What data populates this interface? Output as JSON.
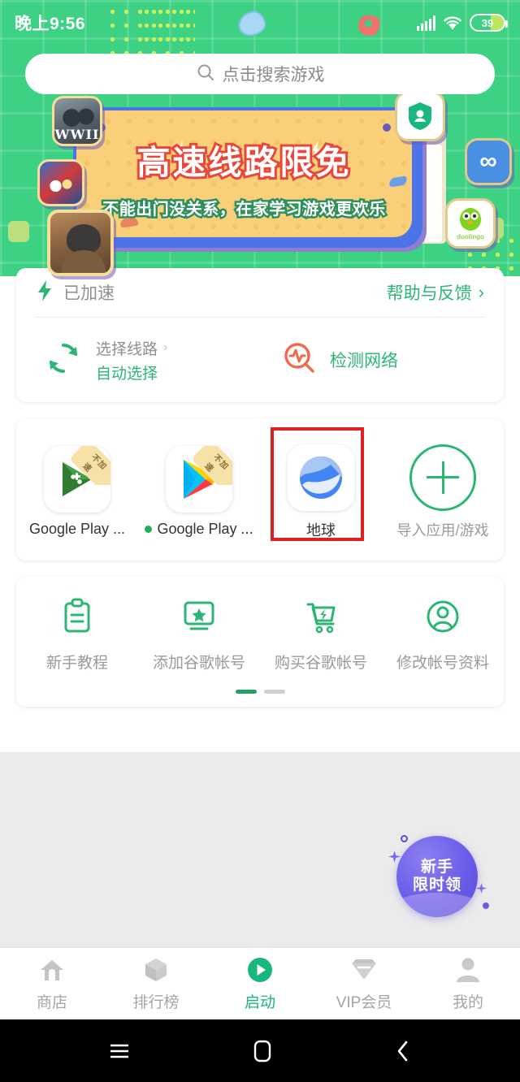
{
  "statusbar": {
    "time": "晚上9:56",
    "battery_percent": "39",
    "signal_icon": "signal-bars-icon",
    "wifi_icon": "wifi-icon",
    "battery_icon": "battery-icon"
  },
  "search": {
    "placeholder": "点击搜索游戏",
    "icon": "search-icon"
  },
  "banner": {
    "title": "高速线路限免",
    "subtitle": "不能出门没关系，在家学习游戏更欢乐",
    "tiles": [
      {
        "name": "wwii-game-tile",
        "label": "WWII"
      },
      {
        "name": "sports-game-tile",
        "label": ""
      },
      {
        "name": "soldier-game-tile",
        "label": ""
      },
      {
        "name": "vip-app-tile",
        "label": ""
      },
      {
        "name": "kuaishou-app-tile",
        "label": "∞"
      },
      {
        "name": "duolingo-app-tile",
        "label": "duolingo"
      }
    ]
  },
  "status_card": {
    "accel_label": "已加速",
    "accel_icon": "lightning-icon",
    "help_label": "帮助与反馈",
    "help_chevron": "›",
    "route_icon": "refresh-circular-icon",
    "route_title": "选择线路",
    "route_chevron": "›",
    "route_value": "自动选择",
    "detect_icon": "network-pulse-icon",
    "detect_label": "检测网络"
  },
  "apps": {
    "items": [
      {
        "label": "Google Play ...",
        "icon": "google-play-games-icon",
        "badge": "不加速",
        "has_badge": true,
        "has_dot": false
      },
      {
        "label": "Google Play ...",
        "icon": "google-play-store-icon",
        "badge": "不加速",
        "has_badge": true,
        "has_dot": true
      },
      {
        "label": "地球",
        "icon": "google-earth-icon",
        "badge": "",
        "has_badge": false,
        "has_dot": false
      }
    ],
    "add_label": "导入应用/游戏",
    "add_icon": "plus-circle-icon"
  },
  "services": {
    "items": [
      {
        "label": "新手教程",
        "icon": "clipboard-icon"
      },
      {
        "label": "添加谷歌帐号",
        "icon": "monitor-star-icon"
      },
      {
        "label": "购买谷歌帐号",
        "icon": "cart-lightning-icon"
      },
      {
        "label": "修改帐号资料",
        "icon": "user-circle-icon"
      }
    ],
    "pages": 2,
    "active_page": 1
  },
  "promo": {
    "line1": "新手",
    "line2": "限时领"
  },
  "bottom_nav": {
    "items": [
      {
        "label": "商店",
        "icon": "home-icon",
        "active": false
      },
      {
        "label": "排行榜",
        "icon": "cube-icon",
        "active": false
      },
      {
        "label": "启动",
        "icon": "play-circle-icon",
        "active": true
      },
      {
        "label": "VIP会员",
        "icon": "diamond-icon",
        "active": false
      },
      {
        "label": "我的",
        "icon": "person-icon",
        "active": false
      }
    ]
  },
  "android_nav": {
    "menu_icon": "menu-icon",
    "home_icon": "home-square-icon",
    "back_icon": "back-chevron-icon"
  },
  "colors": {
    "hero_green": "#3dd183",
    "accent_green": "#2bb673",
    "active_nav": "#17b77d",
    "banner_yellow": "#f9cf7a",
    "banner_blue": "#4a74e8",
    "title_red": "#e8483c",
    "detect_orange": "#f06a4d",
    "highlight_red": "#e02020",
    "promo_purple": "#6b5ce8",
    "gray_bg": "#ebebeb"
  }
}
